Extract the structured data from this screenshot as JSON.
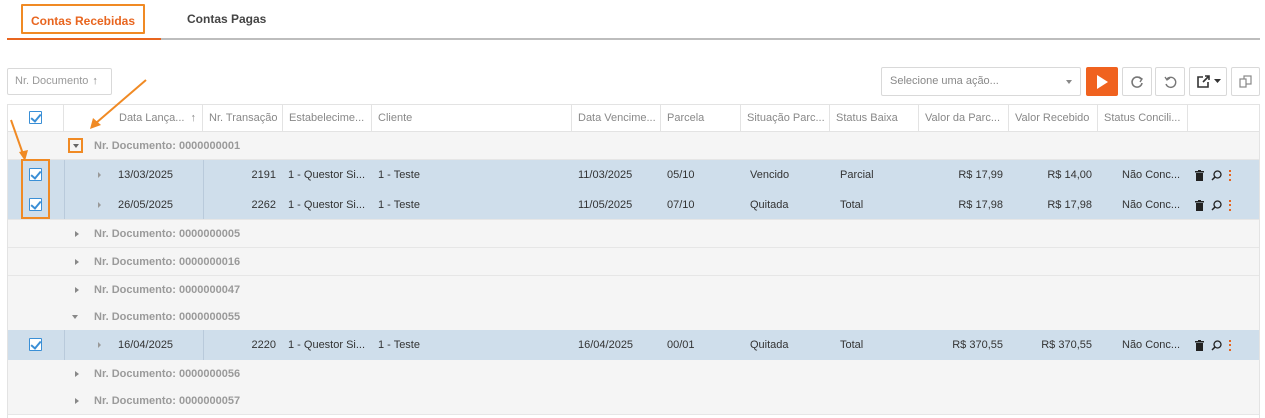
{
  "tabs": [
    {
      "label": "Contas Recebidas",
      "active": true
    },
    {
      "label": "Contas Pagas",
      "active": false
    }
  ],
  "toolbar": {
    "sort_label": "Nr. Documento",
    "sort_direction_glyph": "↑",
    "action_select_placeholder": "Selecione uma ação...",
    "buttons": [
      "play-icon",
      "refresh-icon",
      "undo-icon",
      "export-icon",
      "columns-icon"
    ],
    "accent_color": "#f0621f"
  },
  "columns": [
    "Data Lança...",
    "Nr. Transação",
    "Estabelecime...",
    "Cliente",
    "Data Vencime...",
    "Parcela",
    "Situação Parc...",
    "Status Baixa",
    "Valor da Parc...",
    "Valor Recebido",
    "Status Concili..."
  ],
  "first_column_sort_glyph": "↑",
  "groups": [
    {
      "label": "Nr. Documento: 0000000001",
      "expanded": true,
      "rows": [
        {
          "checked": true,
          "data_lancamento": "13/03/2025",
          "nr_transacao": "2191",
          "estabelecimento": "1 - Questor Si...",
          "cliente": "1 - Teste",
          "data_vencimento": "11/03/2025",
          "parcela": "05/10",
          "situacao": "Vencido",
          "status_baixa": "Parcial",
          "valor_parcela": "R$ 17,99",
          "valor_recebido": "R$ 14,00",
          "status_conciliacao": "Não Conc..."
        },
        {
          "checked": true,
          "data_lancamento": "26/05/2025",
          "nr_transacao": "2262",
          "estabelecimento": "1 - Questor Si...",
          "cliente": "1 - Teste",
          "data_vencimento": "11/05/2025",
          "parcela": "07/10",
          "situacao": "Quitada",
          "status_baixa": "Total",
          "valor_parcela": "R$ 17,98",
          "valor_recebido": "R$ 17,98",
          "status_conciliacao": "Não Conc..."
        }
      ]
    },
    {
      "label": "Nr. Documento: 0000000005",
      "expanded": false,
      "rows": []
    },
    {
      "label": "Nr. Documento: 0000000016",
      "expanded": false,
      "rows": []
    },
    {
      "label": "Nr. Documento: 0000000047",
      "expanded": false,
      "rows": []
    },
    {
      "label": "Nr. Documento: 0000000055",
      "expanded": true,
      "rows": [
        {
          "checked": true,
          "data_lancamento": "16/04/2025",
          "nr_transacao": "2220",
          "estabelecimento": "1 - Questor Si...",
          "cliente": "1 - Teste",
          "data_vencimento": "16/04/2025",
          "parcela": "00/01",
          "situacao": "Quitada",
          "status_baixa": "Total",
          "valor_parcela": "R$ 370,55",
          "valor_recebido": "R$ 370,55",
          "status_conciliacao": "Não Conc..."
        }
      ]
    },
    {
      "label": "Nr. Documento: 0000000056",
      "expanded": false,
      "rows": []
    },
    {
      "label": "Nr. Documento: 0000000057",
      "expanded": false,
      "rows": []
    }
  ],
  "annotation_color": "#f08a24",
  "selected_row_color": "#cfdeeb"
}
